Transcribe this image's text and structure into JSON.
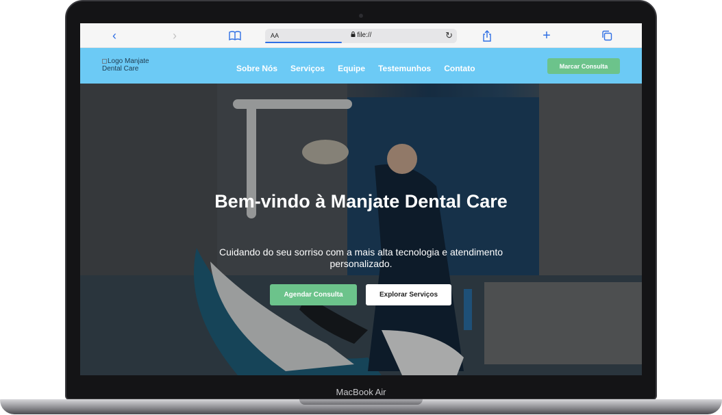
{
  "device": {
    "label": "MacBook Air"
  },
  "browser": {
    "text_size_label": "AA",
    "url": "file://",
    "icons": {
      "back": "chevron-left-icon",
      "forward": "chevron-right-icon",
      "bookmarks": "book-icon",
      "lock": "lock-icon",
      "reload": "reload-icon",
      "share": "share-icon",
      "new_tab": "plus-icon",
      "tabs": "tabs-icon"
    }
  },
  "site": {
    "logo_alt": "Logo Manjate Dental Care",
    "nav": [
      "Sobre Nós",
      "Serviços",
      "Equipe",
      "Testemunhos",
      "Contato"
    ],
    "cta_top": "Marcar Consulta",
    "hero": {
      "title": "Bem-vindo à Manjate Dental Care",
      "subtitle": "Cuidando do seu sorriso com a mais alta tecnologia e atendimento personalizado.",
      "primary_button": "Agendar Consulta",
      "secondary_button": "Explorar Serviços"
    },
    "colors": {
      "header_bg": "#6ccaf5",
      "accent_green": "#6cc38b"
    }
  }
}
